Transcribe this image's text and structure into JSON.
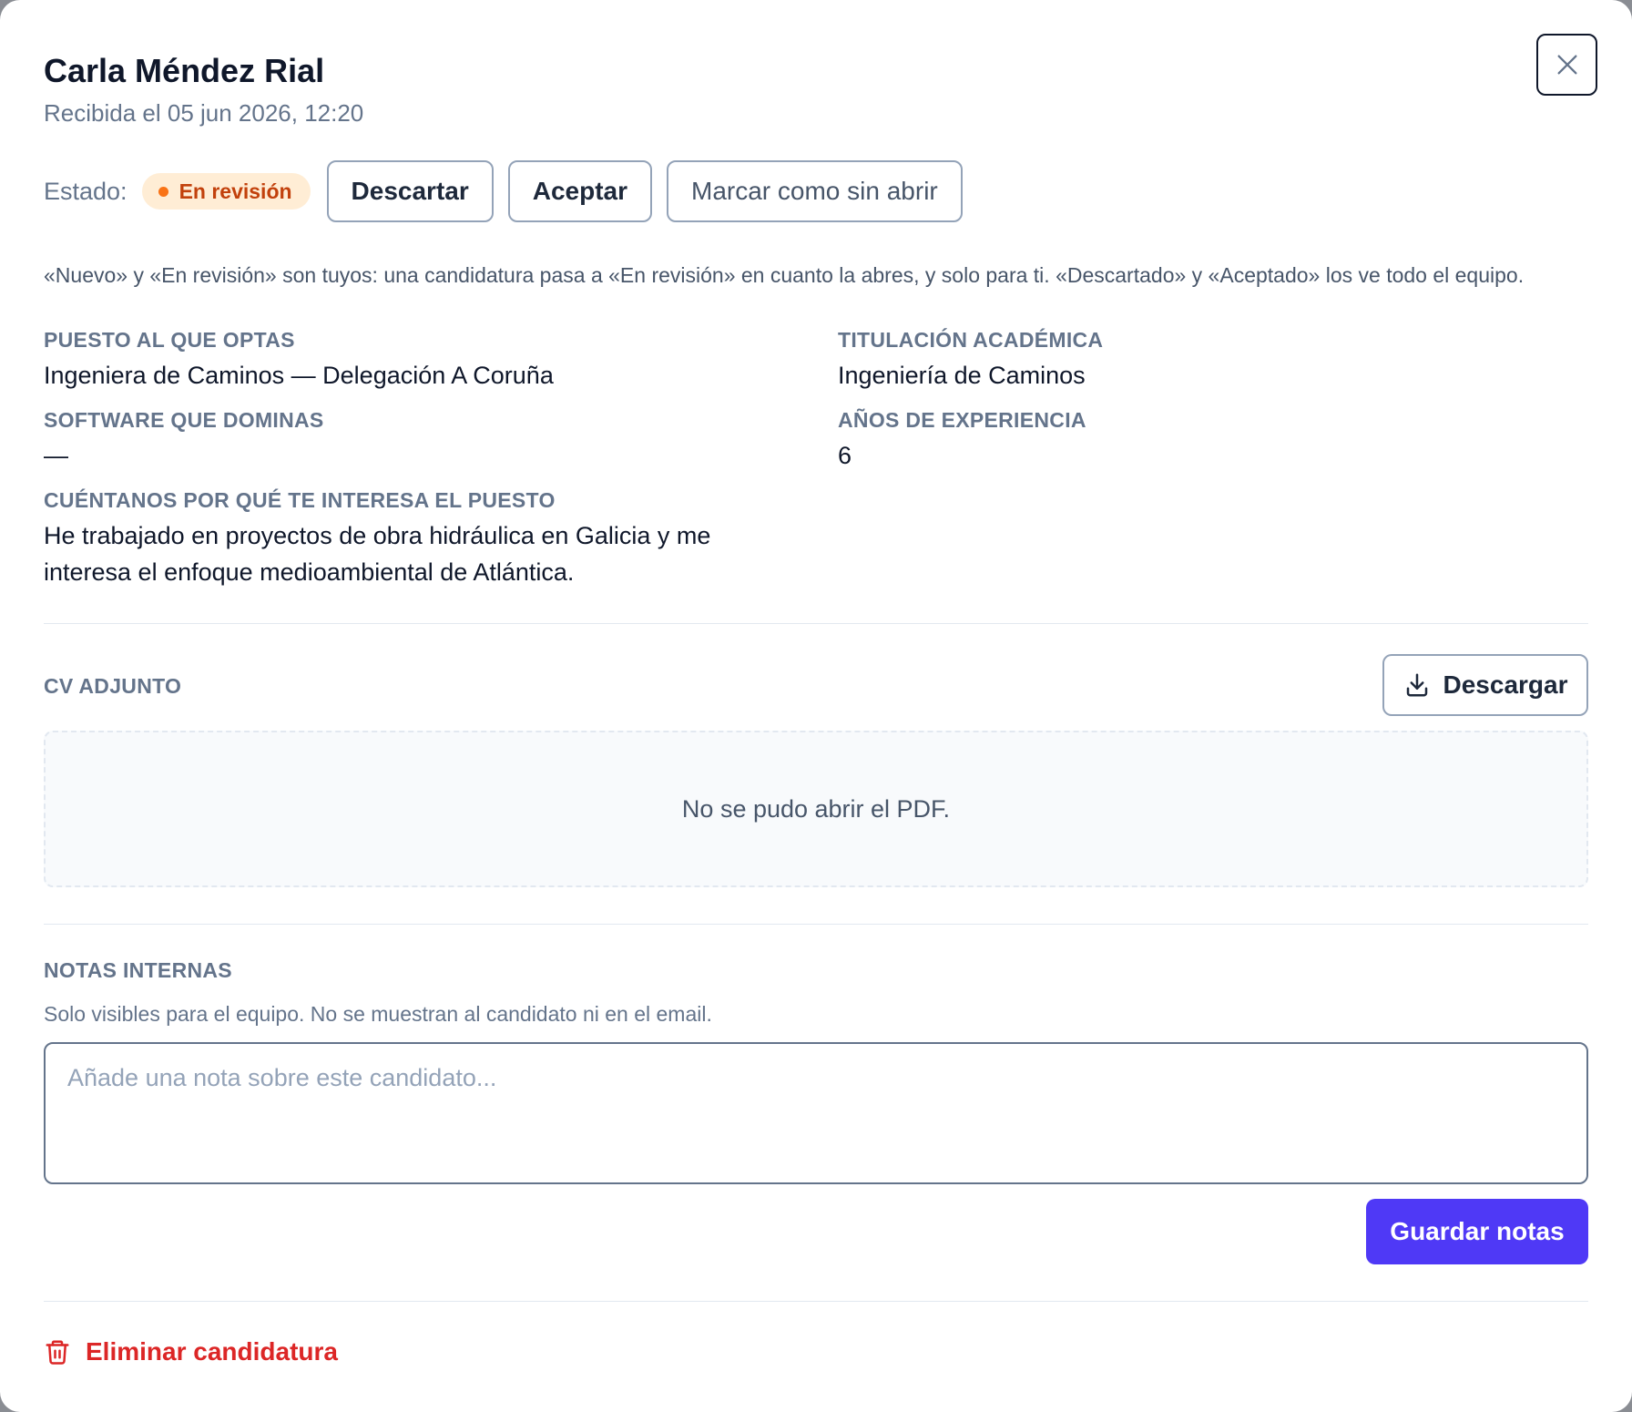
{
  "header": {
    "title": "Carla Méndez Rial",
    "received": "Recibida el 05 jun 2026, 12:20"
  },
  "status": {
    "label": "Estado:",
    "badge": "En revisión",
    "badge_color": "#c2410c",
    "badge_bg": "#ffedd5",
    "actions": {
      "discard": "Descartar",
      "accept": "Aceptar",
      "mark_unopened": "Marcar como sin abrir"
    },
    "note": "«Nuevo» y «En revisión» son tuyos: una candidatura pasa a «En revisión» en cuanto la abres, y solo para ti. «Descartado» y «Aceptado» los ve todo el equipo."
  },
  "fields": {
    "position": {
      "label": "PUESTO AL QUE OPTAS",
      "value": "Ingeniera de Caminos — Delegación A Coruña"
    },
    "degree": {
      "label": "TITULACIÓN ACADÉMICA",
      "value": "Ingeniería de Caminos"
    },
    "software": {
      "label": "SOFTWARE QUE DOMINAS",
      "value": "—"
    },
    "experience": {
      "label": "AÑOS DE EXPERIENCIA",
      "value": "6"
    },
    "motivation": {
      "label": "CUÉNTANOS POR QUÉ TE INTERESA EL PUESTO",
      "line1": "He trabajado en proyectos de obra hidráulica en Galicia y me",
      "line2": "interesa el enfoque medioambiental de Atlántica."
    }
  },
  "cv": {
    "label": "CV ADJUNTO",
    "download": "Descargar",
    "error": "No se pudo abrir el PDF."
  },
  "notes": {
    "label": "NOTAS INTERNAS",
    "help": "Solo visibles para el equipo. No se muestran al candidato ni en el email.",
    "placeholder": "Añade una nota sobre este candidato...",
    "save": "Guardar notas"
  },
  "danger": {
    "delete": "Eliminar candidatura",
    "color": "#dc2626"
  },
  "theme": {
    "primary": "#4f39f6"
  }
}
